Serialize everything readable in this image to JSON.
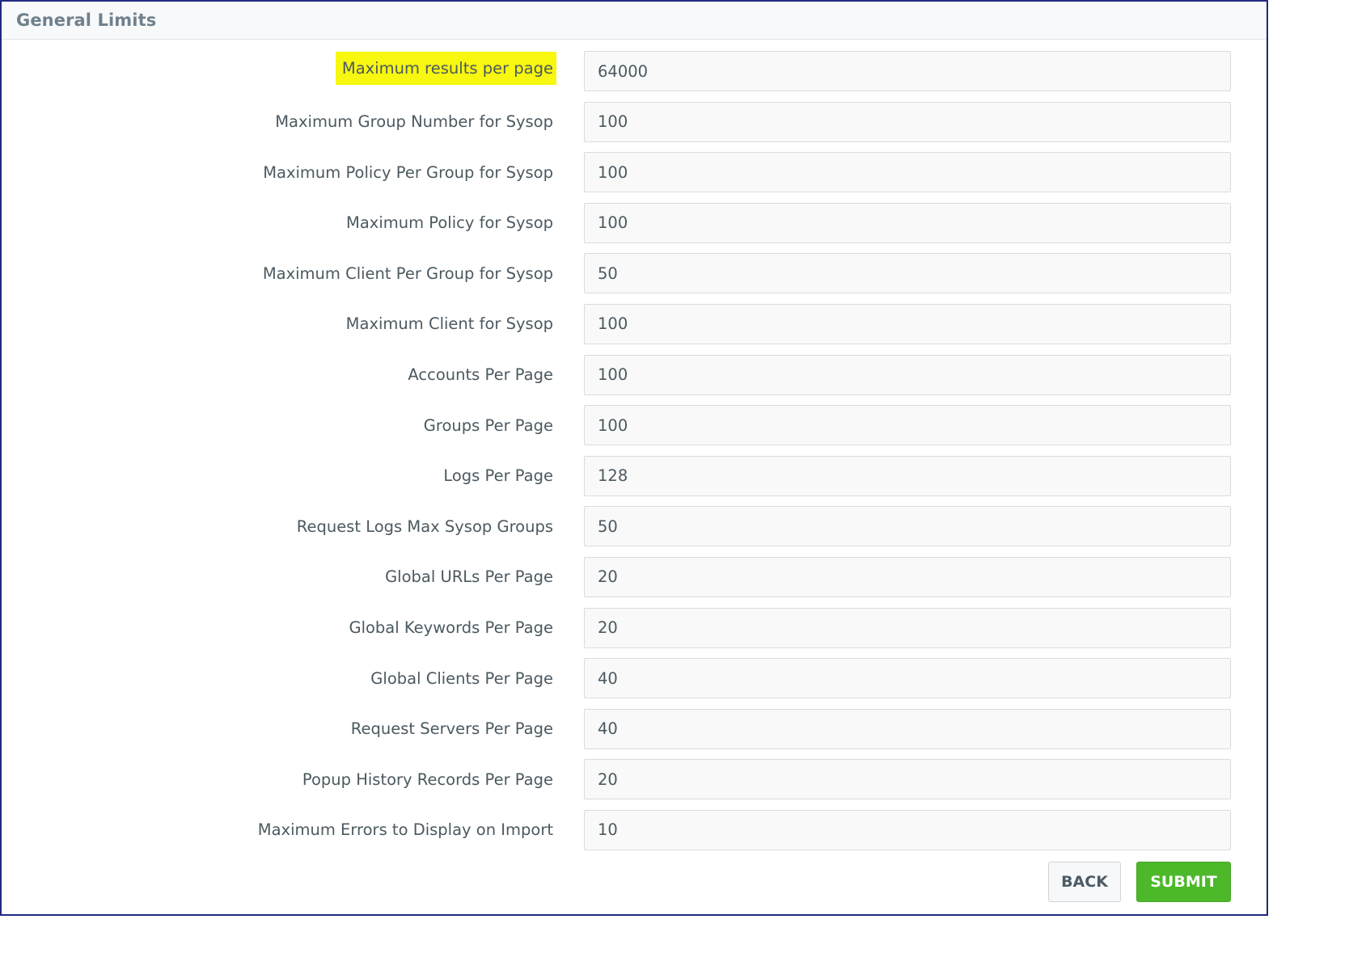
{
  "panel": {
    "title": "General Limits"
  },
  "fields": [
    {
      "label": "Maximum results per page",
      "value": "64000",
      "highlighted": true
    },
    {
      "label": "Maximum Group Number for Sysop",
      "value": "100"
    },
    {
      "label": "Maximum Policy Per Group for Sysop",
      "value": "100"
    },
    {
      "label": "Maximum Policy for Sysop",
      "value": "100"
    },
    {
      "label": "Maximum Client Per Group for Sysop",
      "value": "50"
    },
    {
      "label": "Maximum Client for Sysop",
      "value": "100"
    },
    {
      "label": "Accounts Per Page",
      "value": "100"
    },
    {
      "label": "Groups Per Page",
      "value": "100"
    },
    {
      "label": "Logs Per Page",
      "value": "128"
    },
    {
      "label": "Request Logs Max Sysop Groups",
      "value": "50"
    },
    {
      "label": "Global URLs Per Page",
      "value": "20"
    },
    {
      "label": "Global Keywords Per Page",
      "value": "20"
    },
    {
      "label": "Global Clients Per Page",
      "value": "40"
    },
    {
      "label": "Request Servers Per Page",
      "value": "40"
    },
    {
      "label": "Popup History Records Per Page",
      "value": "20"
    },
    {
      "label": "Maximum Errors to Display on Import",
      "value": "10"
    }
  ],
  "actions": {
    "back_label": "BACK",
    "submit_label": "SUBMIT"
  },
  "colors": {
    "highlight": "#f7f70f",
    "submit": "#4cb82a",
    "frame_border": "#1f2a80"
  }
}
